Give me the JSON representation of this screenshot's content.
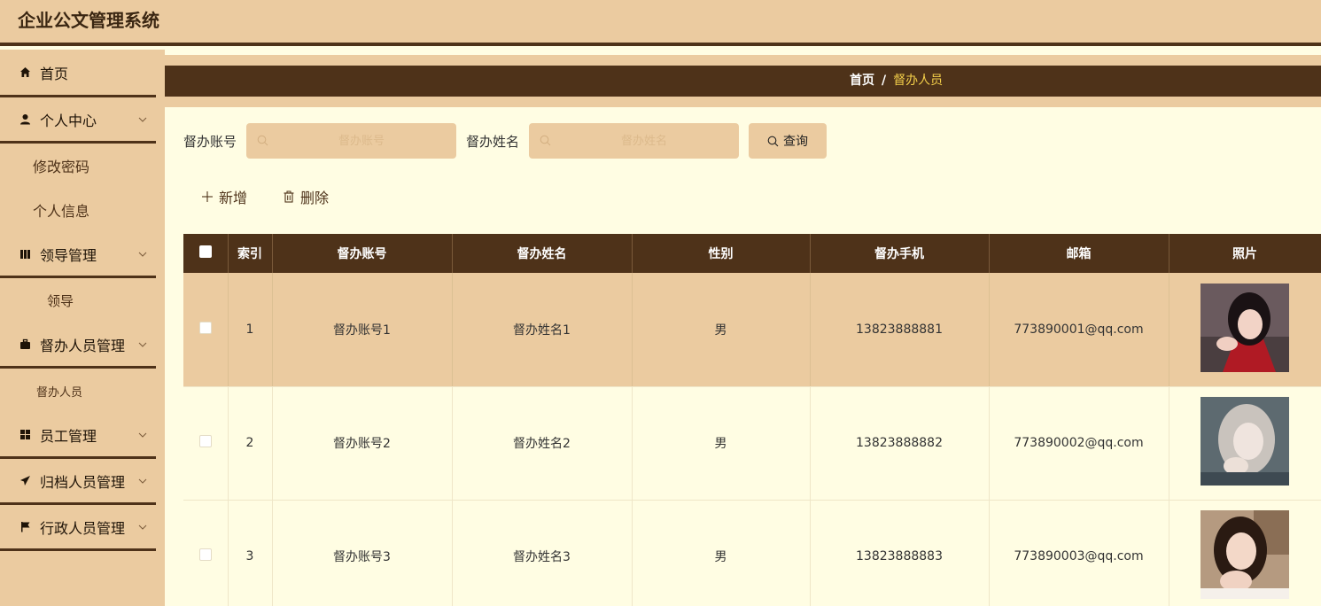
{
  "app": {
    "title": "企业公文管理系统"
  },
  "sidebar": {
    "items": [
      {
        "label": "首页",
        "icon": "home-icon"
      },
      {
        "label": "个人中心",
        "icon": "user-icon",
        "expandable": true
      },
      {
        "label": "修改密码"
      },
      {
        "label": "个人信息"
      },
      {
        "label": "领导管理",
        "icon": "book-icon",
        "expandable": true
      },
      {
        "label": "领导"
      },
      {
        "label": "督办人员管理",
        "icon": "briefcase-icon",
        "expandable": true
      },
      {
        "label": "督办人员"
      },
      {
        "label": "员工管理",
        "icon": "grid-icon",
        "expandable": true
      },
      {
        "label": "归档人员管理",
        "icon": "send-icon",
        "expandable": true
      },
      {
        "label": "行政人员管理",
        "icon": "flag-icon",
        "expandable": true
      }
    ]
  },
  "breadcrumb": {
    "home": "首页",
    "separator": "/",
    "current": "督办人员"
  },
  "search": {
    "account_label": "督办账号",
    "account_placeholder": "督办账号",
    "name_label": "督办姓名",
    "name_placeholder": "督办姓名",
    "query_label": "查询"
  },
  "actions": {
    "add_label": "新增",
    "delete_label": "删除"
  },
  "table": {
    "headers": [
      "索引",
      "督办账号",
      "督办姓名",
      "性别",
      "督办手机",
      "邮箱",
      "照片"
    ],
    "rows": [
      {
        "index": "1",
        "account": "督办账号1",
        "name": "督办姓名1",
        "gender": "男",
        "phone": "13823888881",
        "email": "773890001@qq.com"
      },
      {
        "index": "2",
        "account": "督办账号2",
        "name": "督办姓名2",
        "gender": "男",
        "phone": "13823888882",
        "email": "773890002@qq.com"
      },
      {
        "index": "3",
        "account": "督办账号3",
        "name": "督办姓名3",
        "gender": "男",
        "phone": "13823888883",
        "email": "773890003@qq.com"
      }
    ]
  },
  "colors": {
    "dark_brown": "#4e3219",
    "tan": "#ebcba0",
    "cream": "#fffde3",
    "breadcrumb_active": "#f5d04a"
  }
}
